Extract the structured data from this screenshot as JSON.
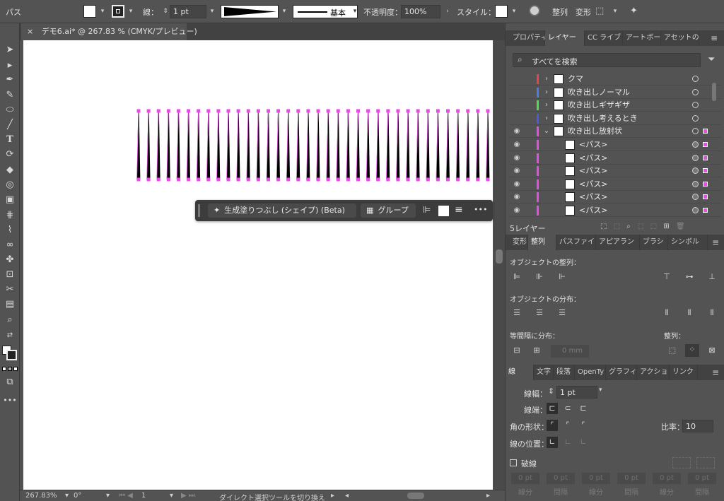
{
  "control_bar": {
    "selection_type": "パス",
    "stroke_label": "線：",
    "stroke_weight": "1 pt",
    "brush_label": "基本",
    "opacity_label": "不透明度：",
    "opacity_value": "100%",
    "style_label": "スタイル：",
    "align_label": "整列",
    "transform_label": "変形"
  },
  "document": {
    "tab_close": "×",
    "tab_title": "デモ6.ai* @ 267.83 % (CMYK/プレビュー)",
    "radial_lines_count": 36,
    "accent_color": "#e84ce6"
  },
  "context_bar": {
    "generative_fill": "生成塗りつぶし (シェイプ) (Beta)",
    "group": "グループ",
    "more": "•••"
  },
  "status_bar": {
    "zoom": "267.83%",
    "rotation": "0°",
    "artboard_num": "1",
    "message": "ダイレクト選択ツールを切り換え"
  },
  "layers_panel": {
    "tabs": [
      "プロパティ",
      "レイヤー",
      "CC ライブ",
      "アートボー",
      "アセットの"
    ],
    "search_placeholder": "すべてを検索",
    "rows": [
      {
        "name": "クマ",
        "color": "#e84545",
        "visible": false,
        "expanded": false,
        "sub": false
      },
      {
        "name": "吹き出しノーマル",
        "color": "#4a7fe0",
        "visible": false,
        "expanded": false,
        "sub": false
      },
      {
        "name": "吹き出しギザギザ",
        "color": "#4ee04a",
        "visible": false,
        "expanded": false,
        "sub": false
      },
      {
        "name": "吹き出し考えるとき",
        "color": "#4a5ae0",
        "visible": false,
        "expanded": false,
        "sub": false
      },
      {
        "name": "吹き出し放射状",
        "color": "#e84ce6",
        "visible": true,
        "expanded": true,
        "sub": false
      },
      {
        "name": "<パス>",
        "color": "#e84ce6",
        "visible": true,
        "sub": true
      },
      {
        "name": "<パス>",
        "color": "#e84ce6",
        "visible": true,
        "sub": true
      },
      {
        "name": "<パス>",
        "color": "#e84ce6",
        "visible": true,
        "sub": true
      },
      {
        "name": "<パス>",
        "color": "#e84ce6",
        "visible": true,
        "sub": true
      },
      {
        "name": "<パス>",
        "color": "#e84ce6",
        "visible": true,
        "sub": true
      },
      {
        "name": "<パス>",
        "color": "#e84ce6",
        "visible": true,
        "sub": true
      }
    ],
    "footer_count": "5レイヤー"
  },
  "align_panel": {
    "tabs": [
      "変形",
      "整列",
      "パスファイ",
      "アピアラン",
      "ブラシ",
      "シンボル"
    ],
    "align_objects": "オブジェクトの整列：",
    "distribute_objects": "オブジェクトの分布：",
    "distribute_spacing": "等間隔に分布：",
    "align_to": "整列：",
    "spacing_value": "0 mm"
  },
  "stroke_panel": {
    "tabs": [
      "線",
      "文字",
      "段落",
      "OpenTy",
      "グラフィ",
      "アクショ",
      "リンク"
    ],
    "weight_label": "線幅：",
    "weight_value": "1 pt",
    "cap_label": "線端：",
    "corner_label": "角の形状：",
    "limit_label": "比率：",
    "limit_value": "10",
    "align_label": "線の位置：",
    "dashed_label": "破線",
    "dash_inputs": [
      "0 pt",
      "0 pt",
      "0 pt",
      "0 pt",
      "0 pt",
      "0 pt"
    ],
    "dash_labels": [
      "線分",
      "間隔",
      "線分",
      "間隔",
      "線分",
      "間隔"
    ]
  }
}
